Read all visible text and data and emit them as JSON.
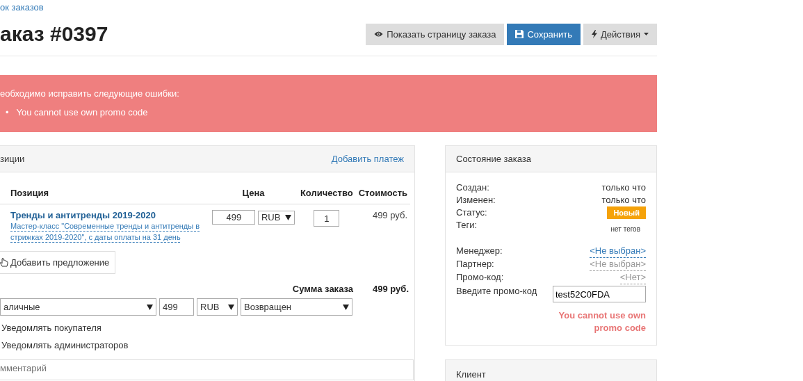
{
  "breadcrumb": "ок заказов",
  "title": "аказ #0397",
  "actions": [
    {
      "kind": "view",
      "label": "Показать страницу заказа"
    },
    {
      "kind": "save",
      "label": "Сохранить"
    },
    {
      "kind": "menu",
      "label": "Действия"
    }
  ],
  "alert": {
    "heading": "еобходимо исправить следующие ошибки:",
    "errors": [
      {
        "bullet": "•",
        "text": "You cannot use own promo code"
      }
    ]
  },
  "positions_panel": {
    "title": "зиции",
    "add_payment_link": "Добавить платеж",
    "columns": [
      "Позиция",
      "Цена",
      "Количество",
      "Стоимость"
    ],
    "rows": [
      {
        "name": "Тренды и антитренды 2019-2020",
        "description": "Мастер-класс \"Современные тренды и антитренды в стрижках 2019-2020\", с даты оплаты на 31 день",
        "price": "499",
        "currency": "RUB",
        "quantity": "1",
        "cost": "499 руб."
      }
    ],
    "add_offer_button": "Добавить предложение",
    "total_label": "Сумма заказа",
    "total_value": "499 руб.",
    "payment": {
      "method": "аличные",
      "amount": "499",
      "currency": "RUB",
      "status": "Возвращен"
    },
    "notify_options": [
      "Уведомлять покупателя",
      "Уведомлять администраторов"
    ],
    "comment_placeholder": "мментарий"
  },
  "status_panel": {
    "title": "Состояние заказа",
    "rows": [
      {
        "kind": "text",
        "label": "Создан:",
        "value": "только что"
      },
      {
        "kind": "text",
        "label": "Изменен:",
        "value": "только что"
      },
      {
        "kind": "badge",
        "label": "Статус:",
        "value": "Новый",
        "color": "#f5a20a"
      },
      {
        "kind": "small",
        "label": "Теги:",
        "value": "нет тегов"
      },
      {
        "kind": "link",
        "label": "Менеджер:",
        "value": "<Не выбран>"
      },
      {
        "kind": "muted-link",
        "label": "Партнер:",
        "value": "<Не выбран>"
      },
      {
        "kind": "muted-link",
        "label": "Промо-код:",
        "value": "<Нет>"
      }
    ],
    "promo_label": "Введите промо-код",
    "promo_value": "test52C0FDA",
    "promo_error": "You cannot use own promo code"
  },
  "client_panel": {
    "title": "Клиент"
  }
}
